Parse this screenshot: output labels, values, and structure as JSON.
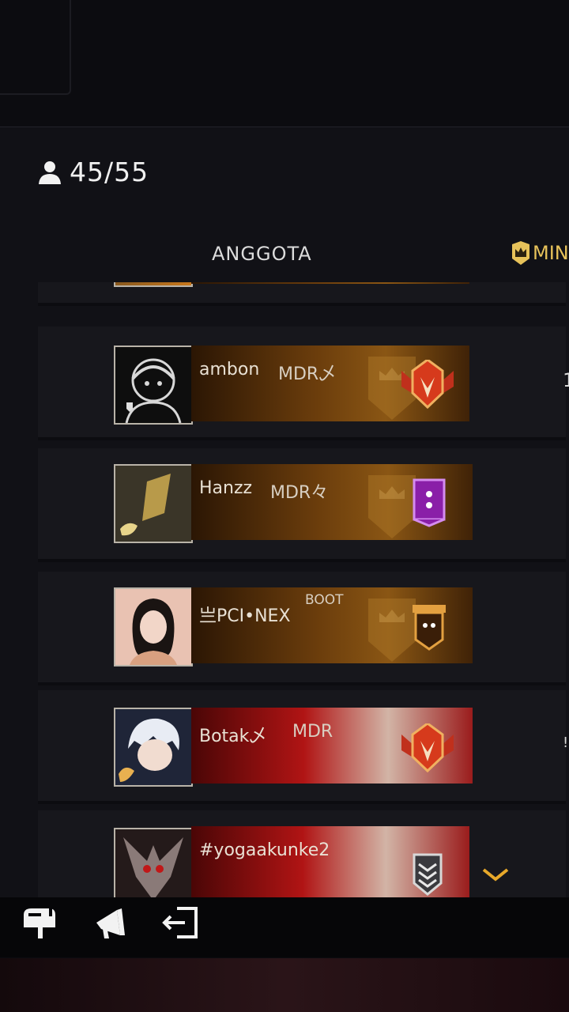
{
  "member_count": "45/55",
  "tabs": [
    {
      "label": "ANGGOTA"
    },
    {
      "label": "MIN"
    }
  ],
  "members": [
    {
      "name": "",
      "tag": "",
      "badge": "crown-badge-icon"
    },
    {
      "name": "ambon",
      "tag": "MDR乄",
      "badge": "heroic-rank-icon",
      "side": "1"
    },
    {
      "name": "Hanzz",
      "tag": "MDR々",
      "badge": "purple-banner-icon"
    },
    {
      "name": "亗PCI•NEX",
      "tag": "BOOT",
      "badge": "orange-banner-icon"
    },
    {
      "name": "Botak乄",
      "tag": "MDR",
      "badge": "heroic-rank-icon",
      "side": "!!"
    },
    {
      "name": "#yogaakunke2",
      "tag": "",
      "badge": "silver-chevron-icon"
    }
  ],
  "colors": {
    "accent_gold": "#e7c25a",
    "banner_gold": "#8a5614",
    "banner_red": "#b01414"
  }
}
